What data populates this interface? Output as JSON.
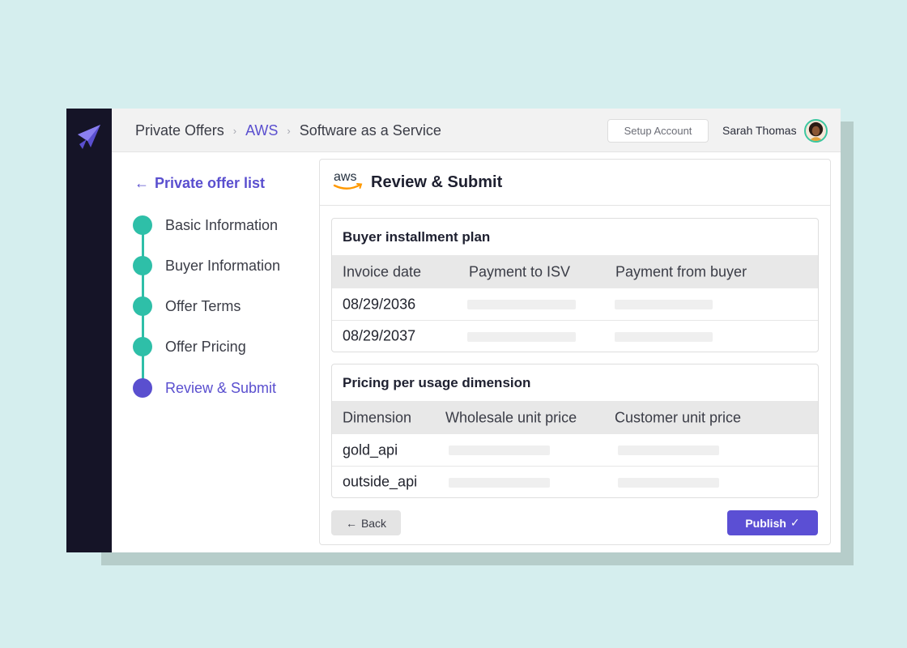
{
  "breadcrumb": {
    "items": [
      "Private Offers",
      "AWS",
      "Software as a Service"
    ]
  },
  "header": {
    "setup_label": "Setup Account",
    "user_name": "Sarah Thomas"
  },
  "sidebar": {
    "back_label": "Private offer list",
    "steps": [
      "Basic Information",
      "Buyer Information",
      "Offer Terms",
      "Offer Pricing",
      "Review & Submit"
    ],
    "active_step": "Review & Submit"
  },
  "main": {
    "logo_text": "aws",
    "title": "Review & Submit"
  },
  "installment": {
    "title": "Buyer installment plan",
    "columns": [
      "Invoice date",
      "Payment to ISV",
      "Payment from buyer"
    ],
    "rows": [
      {
        "date": "08/29/2036"
      },
      {
        "date": "08/29/2037"
      }
    ]
  },
  "pricing": {
    "title": "Pricing per usage dimension",
    "columns": [
      "Dimension",
      "Wholesale unit price",
      "Customer unit price"
    ],
    "rows": [
      {
        "dimension": "gold_api"
      },
      {
        "dimension": "outside_api"
      }
    ]
  },
  "actions": {
    "back_label": "Back",
    "publish_label": "Publish"
  },
  "colors": {
    "accent": "#5a4fcf",
    "step_complete": "#2ebfa8",
    "rail": "#151427",
    "background": "#d5eeee"
  }
}
